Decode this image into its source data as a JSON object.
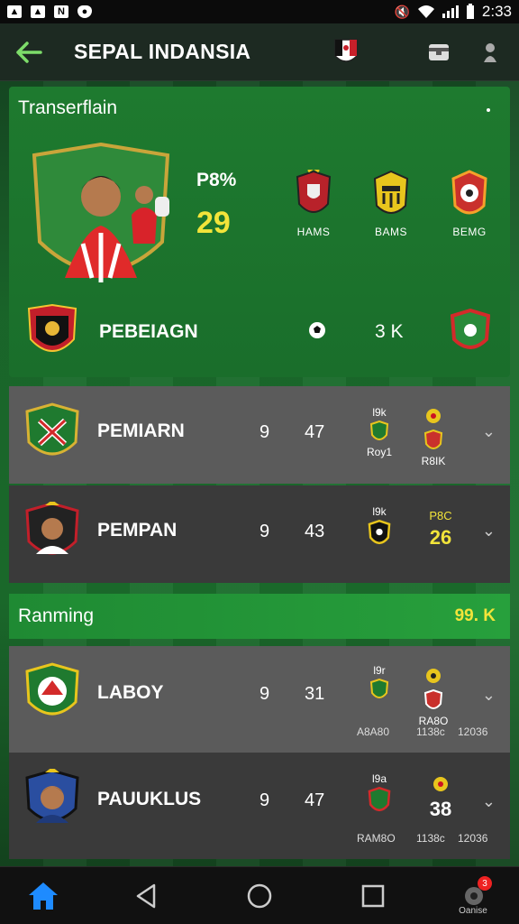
{
  "status_bar": {
    "time": "2:33"
  },
  "header": {
    "title": "SEPAL INDANSIA"
  },
  "hero": {
    "section_title": "Transerflain",
    "stat_label": "P8%",
    "stat_value": "29",
    "badges": [
      {
        "label": "HAMS",
        "color": "#b8222a"
      },
      {
        "label": "BAMS",
        "color": "#e8c51d"
      },
      {
        "label": "BEMG",
        "color": "#c9302c"
      }
    ],
    "club_row": {
      "name": "PEBEIAGN",
      "value": "3 K"
    }
  },
  "players": [
    {
      "name": "PEMIARN",
      "num1": "9",
      "num2": "47",
      "mini1_top": "l9k",
      "mini1_bottom": "Roy1",
      "mini2_text": "R8IK",
      "mini2_value": ""
    },
    {
      "name": "PEMPAN",
      "num1": "9",
      "num2": "43",
      "mini1_top": "l9k",
      "mini1_bottom": "",
      "mini2_text": "P8C",
      "mini2_value": "26"
    }
  ],
  "ranking": {
    "title": "Ranming",
    "value": "99. K"
  },
  "ranked": [
    {
      "name": "LABOY",
      "num1": "9",
      "num2": "31",
      "mini1_top": "l9r",
      "mini2_text": "RA8O",
      "sub": [
        "A8A80",
        "1138c",
        "12036"
      ],
      "mini2_value": ""
    },
    {
      "name": "PAUUKLUS",
      "num1": "9",
      "num2": "47",
      "mini1_top": "l9a",
      "mini2_text": "",
      "sub": [
        "RAM8O",
        "1138c",
        "12036"
      ],
      "mini2_value": "38"
    }
  ],
  "nav": {
    "badge_count": "3",
    "last_label": "Oanise"
  },
  "colors": {
    "accent_green": "#7ddc6a",
    "value_yellow": "#f2e43a"
  }
}
